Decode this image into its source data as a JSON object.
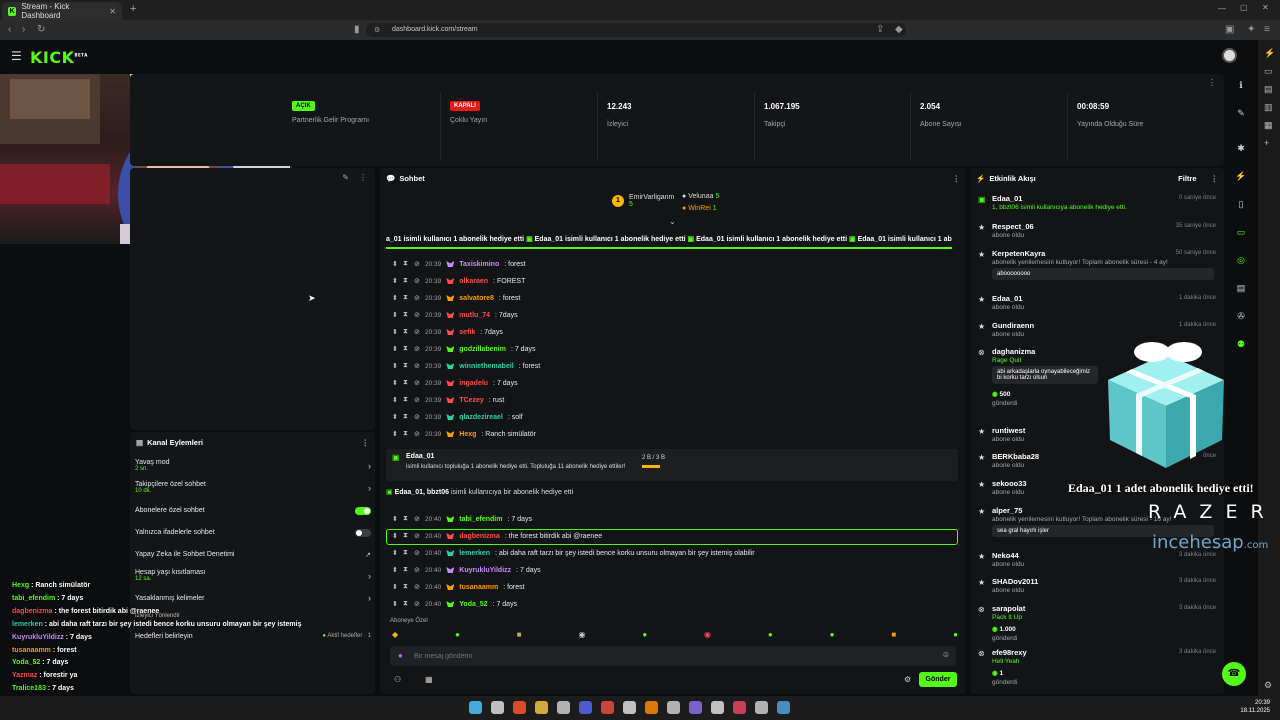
{
  "browser": {
    "tab_title": "Stream - Kick Dashboard",
    "url": "dashboard.kick.com/stream"
  },
  "header": {
    "logo": "KICK",
    "logo_sup": "BETA"
  },
  "stats": {
    "affiliate": {
      "badge": "AÇIK",
      "label": "Partnerlik Gelir Programı"
    },
    "multistream": {
      "badge": "KAPALI",
      "label": "Çoklu Yayın"
    },
    "viewers": {
      "value": "12.243",
      "label": "İzleyici"
    },
    "followers": {
      "value": "1.067.195",
      "label": "Takipçi"
    },
    "subs": {
      "value": "2.054",
      "label": "Abone Sayısı"
    },
    "uptime": {
      "value": "00:08:59",
      "label": "Yayında Olduğu Süre"
    }
  },
  "channel_actions": {
    "title": "Kanal Eylemleri",
    "items": [
      {
        "label": "Yavaş mod",
        "sub": "2 sn."
      },
      {
        "label": "Takipçilere özel sohbet",
        "sub": "10 dk."
      },
      {
        "label": "Abonelere özel sohbet",
        "sub": ""
      },
      {
        "label": "Yalnızca ifadelerle sohbet",
        "sub": ""
      },
      {
        "label": "Yapay Zeka ile Sohbet Denetimi",
        "sub": ""
      },
      {
        "label": "Hesap yaşı kısıtlaması",
        "sub": "12 sa."
      },
      {
        "label": "Yasaklanmış kelimeler",
        "sub": ""
      },
      {
        "label": "Hedefleri belirleyin",
        "sub": ""
      }
    ],
    "goals_badge": "Aktif hedefler · 1",
    "overlap_text": "İzleyici Yönlendir"
  },
  "overlay_chat": [
    {
      "user": "Hexg",
      "msg": "Ranch simülatör",
      "color": "#53fc18"
    },
    {
      "user": "tabi_efendim",
      "msg": "7 days",
      "color": "#53fc18"
    },
    {
      "user": "dagbenizma",
      "msg": "the forest bitirdik abi @raenee",
      "color": "#ff4d4d"
    },
    {
      "user": "lemerken",
      "msg": "abi daha raft tarzı bir şey istedi bence korku unsuru olmayan bir şey istemiş",
      "color": "#2ad4a0"
    },
    {
      "user": "KuyrukluYildizz",
      "msg": "7 days",
      "color": "#c48cff"
    },
    {
      "user": "tusanaamm",
      "msg": "forest",
      "color": "#ff9d00"
    },
    {
      "user": "Yoda_52",
      "msg": "7 days",
      "color": "#53fc18"
    },
    {
      "user": "Yazmaz",
      "msg": "forestir ya",
      "color": "#ff4d4d"
    },
    {
      "user": "Tralice183",
      "msg": "7 days",
      "color": "#53fc18"
    }
  ],
  "chat": {
    "title": "Sohbet",
    "top_gifters": [
      {
        "name": "EmirVarliganm",
        "count": "5"
      },
      {
        "name": "Velunaa",
        "count": "5"
      },
      {
        "name": "WinRei",
        "count": "1"
      }
    ],
    "ticker_segment": "Edaa_01 isimli kullanıcı 1 abonelik hediye etti",
    "ticker_lead": "a_01 isimli kullanıcı 1 abonelik hediye etti",
    "messages_a": [
      {
        "time": "20:39",
        "user": "Taxiskimino",
        "msg": "forest",
        "color": "#c48cff"
      },
      {
        "time": "20:39",
        "user": "olkaraen",
        "msg": "FOREST",
        "color": "#ff4d4d"
      },
      {
        "time": "20:39",
        "user": "salvatore8",
        "msg": "forest",
        "color": "#ff9d00"
      },
      {
        "time": "20:39",
        "user": "mutlu_74",
        "msg": "7days",
        "color": "#ff4d4d"
      },
      {
        "time": "20:39",
        "user": "sefik",
        "msg": "7days",
        "color": "#ff4d4d"
      },
      {
        "time": "20:39",
        "user": "godzillabenim",
        "msg": "7 days",
        "color": "#53fc18"
      },
      {
        "time": "20:39",
        "user": "winniethemabeil",
        "msg": "forest",
        "color": "#2ad4a0"
      },
      {
        "time": "20:39",
        "user": "ingadelu",
        "msg": "7 days",
        "color": "#ff4d4d"
      },
      {
        "time": "20:39",
        "user": "TCezey",
        "msg": "rust",
        "color": "#ff4d4d"
      },
      {
        "time": "20:39",
        "user": "qlazdezireael",
        "msg": "solf",
        "color": "#2ad4a0"
      },
      {
        "time": "20:39",
        "user": "Hexg",
        "msg": "Ranch simülatör",
        "color": "#ff9d00"
      }
    ],
    "gift_event": {
      "user": "Edaa_01",
      "text": "isimli kullanıcı topluluğa 1 abonelik hediye etti. Topluluğa 11 abonelik hediye ettiler!",
      "progress": "2 B / 3 B"
    },
    "gift_event2": {
      "user": "Edaa_01, bbzt06",
      "text": "isimli kullanıcıya bir abonelik hediye etti"
    },
    "messages_b": [
      {
        "time": "20:40",
        "user": "tabi_efendim",
        "msg": "7 days",
        "color": "#53fc18"
      },
      {
        "time": "20:40",
        "user": "dagbenizma",
        "msg": "the forest bitirdik abi @raenee",
        "color": "#ff4d4d"
      },
      {
        "time": "20:40",
        "user": "lemerken",
        "msg": "abi daha raft tarzı bir şey istedi bence korku unsuru olmayan bir şey istemiş olabilir",
        "color": "#2ad4a0"
      },
      {
        "time": "20:40",
        "user": "KuyrukluYildizz",
        "msg": "7 days",
        "color": "#c48cff"
      },
      {
        "time": "20:40",
        "user": "tusanaamm",
        "msg": "forest",
        "color": "#ff9d00"
      },
      {
        "time": "20:40",
        "user": "Yoda_52",
        "msg": "7 days",
        "color": "#53fc18"
      }
    ],
    "subscriber_emotes_label": "Aboneye Özel",
    "input_placeholder": "Bir mesaj gönderin",
    "send_label": "Gönder"
  },
  "events": {
    "title": "Etkinlik Akışı",
    "filter_label": "Filtre",
    "items": [
      {
        "name": "Edaa_01",
        "desc": "1, bbzt06 isimli kullanıcıya abonelik hediye etti.",
        "time": "0 saniye önce"
      },
      {
        "name": "Respect_06",
        "desc": "abone oldu",
        "time": "35 saniye önce"
      },
      {
        "name": "KerpetenKayra",
        "desc": "abonelik yenilemesini kutluyor! Toplam abonelik süresi - 4 ay!",
        "time": "50 saniye önce",
        "msg": "aboooooooo"
      },
      {
        "name": "Edaa_01",
        "desc": "abone oldu",
        "time": "1 dakika önce"
      },
      {
        "name": "Gundiraenn",
        "desc": "abone oldu",
        "time": "1 dakika önce"
      },
      {
        "name": "daghanizma",
        "desc": "Rage Quit",
        "time": "",
        "msg": "abi arkadaşlarla oynayabileceğimiz bi korku tarzı olsun",
        "amount": "500",
        "after": "gönderdi"
      },
      {
        "name": "runtiwest",
        "desc": "abone oldu",
        "time": ""
      },
      {
        "name": "BERKbaba28",
        "desc": "abone oldu",
        "time": "önce"
      },
      {
        "name": "sekooo33",
        "desc": "abone oldu",
        "time": ""
      },
      {
        "name": "alper_75",
        "desc": "abonelik yenilemesini kutluyor! Toplam abonelik süresi - 16 ay!",
        "time": "",
        "msg": "sea gral hayırlı işler"
      },
      {
        "name": "Neko44",
        "desc": "abone oldu",
        "time": "3 dakika önce"
      },
      {
        "name": "SHADov2011",
        "desc": "abone oldu",
        "time": "3 dakika önce"
      },
      {
        "name": "sarapolat",
        "desc": "Pack It Up",
        "time": "3 dakika önce",
        "amount": "1.000",
        "after": "gönderdi"
      },
      {
        "name": "efe98rexy",
        "desc": "Hell Yeah",
        "time": "3 dakika önce",
        "amount": "1",
        "after": "gönderdi"
      }
    ]
  },
  "overlay": {
    "gift_text": "Edaa_01 1 adet abonelik hediye etti!",
    "razer": "RAZER",
    "incehesap": "incehesap",
    "incehesap_tld": ".com"
  },
  "clock": {
    "time": "20:39",
    "date": "18.11.2025"
  },
  "colors": {
    "accent": "#53fc18",
    "bg": "#0b0d0f",
    "panel": "#131416",
    "danger": "#e91916"
  }
}
